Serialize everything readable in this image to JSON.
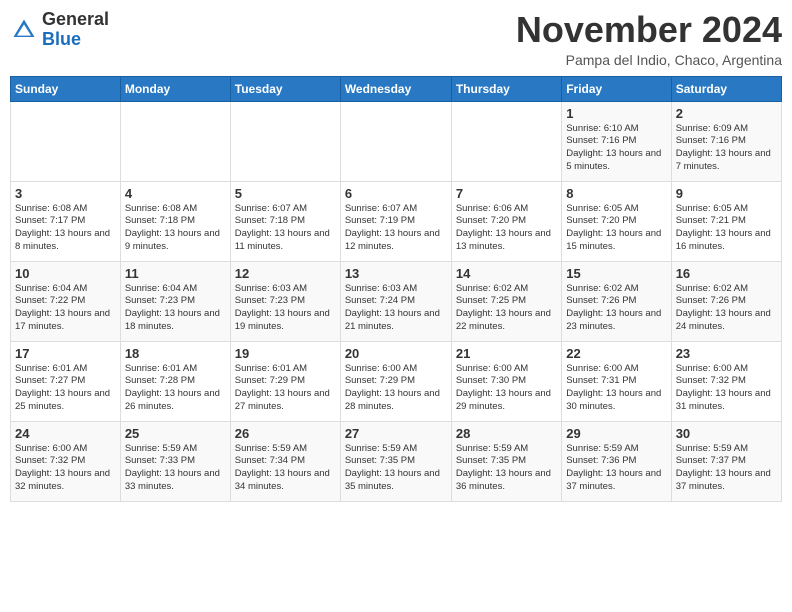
{
  "header": {
    "logo_general": "General",
    "logo_blue": "Blue",
    "month_title": "November 2024",
    "location": "Pampa del Indio, Chaco, Argentina"
  },
  "days_of_week": [
    "Sunday",
    "Monday",
    "Tuesday",
    "Wednesday",
    "Thursday",
    "Friday",
    "Saturday"
  ],
  "weeks": [
    [
      {
        "day": "",
        "info": ""
      },
      {
        "day": "",
        "info": ""
      },
      {
        "day": "",
        "info": ""
      },
      {
        "day": "",
        "info": ""
      },
      {
        "day": "",
        "info": ""
      },
      {
        "day": "1",
        "info": "Sunrise: 6:10 AM\nSunset: 7:16 PM\nDaylight: 13 hours and 5 minutes."
      },
      {
        "day": "2",
        "info": "Sunrise: 6:09 AM\nSunset: 7:16 PM\nDaylight: 13 hours and 7 minutes."
      }
    ],
    [
      {
        "day": "3",
        "info": "Sunrise: 6:08 AM\nSunset: 7:17 PM\nDaylight: 13 hours and 8 minutes."
      },
      {
        "day": "4",
        "info": "Sunrise: 6:08 AM\nSunset: 7:18 PM\nDaylight: 13 hours and 9 minutes."
      },
      {
        "day": "5",
        "info": "Sunrise: 6:07 AM\nSunset: 7:18 PM\nDaylight: 13 hours and 11 minutes."
      },
      {
        "day": "6",
        "info": "Sunrise: 6:07 AM\nSunset: 7:19 PM\nDaylight: 13 hours and 12 minutes."
      },
      {
        "day": "7",
        "info": "Sunrise: 6:06 AM\nSunset: 7:20 PM\nDaylight: 13 hours and 13 minutes."
      },
      {
        "day": "8",
        "info": "Sunrise: 6:05 AM\nSunset: 7:20 PM\nDaylight: 13 hours and 15 minutes."
      },
      {
        "day": "9",
        "info": "Sunrise: 6:05 AM\nSunset: 7:21 PM\nDaylight: 13 hours and 16 minutes."
      }
    ],
    [
      {
        "day": "10",
        "info": "Sunrise: 6:04 AM\nSunset: 7:22 PM\nDaylight: 13 hours and 17 minutes."
      },
      {
        "day": "11",
        "info": "Sunrise: 6:04 AM\nSunset: 7:23 PM\nDaylight: 13 hours and 18 minutes."
      },
      {
        "day": "12",
        "info": "Sunrise: 6:03 AM\nSunset: 7:23 PM\nDaylight: 13 hours and 19 minutes."
      },
      {
        "day": "13",
        "info": "Sunrise: 6:03 AM\nSunset: 7:24 PM\nDaylight: 13 hours and 21 minutes."
      },
      {
        "day": "14",
        "info": "Sunrise: 6:02 AM\nSunset: 7:25 PM\nDaylight: 13 hours and 22 minutes."
      },
      {
        "day": "15",
        "info": "Sunrise: 6:02 AM\nSunset: 7:26 PM\nDaylight: 13 hours and 23 minutes."
      },
      {
        "day": "16",
        "info": "Sunrise: 6:02 AM\nSunset: 7:26 PM\nDaylight: 13 hours and 24 minutes."
      }
    ],
    [
      {
        "day": "17",
        "info": "Sunrise: 6:01 AM\nSunset: 7:27 PM\nDaylight: 13 hours and 25 minutes."
      },
      {
        "day": "18",
        "info": "Sunrise: 6:01 AM\nSunset: 7:28 PM\nDaylight: 13 hours and 26 minutes."
      },
      {
        "day": "19",
        "info": "Sunrise: 6:01 AM\nSunset: 7:29 PM\nDaylight: 13 hours and 27 minutes."
      },
      {
        "day": "20",
        "info": "Sunrise: 6:00 AM\nSunset: 7:29 PM\nDaylight: 13 hours and 28 minutes."
      },
      {
        "day": "21",
        "info": "Sunrise: 6:00 AM\nSunset: 7:30 PM\nDaylight: 13 hours and 29 minutes."
      },
      {
        "day": "22",
        "info": "Sunrise: 6:00 AM\nSunset: 7:31 PM\nDaylight: 13 hours and 30 minutes."
      },
      {
        "day": "23",
        "info": "Sunrise: 6:00 AM\nSunset: 7:32 PM\nDaylight: 13 hours and 31 minutes."
      }
    ],
    [
      {
        "day": "24",
        "info": "Sunrise: 6:00 AM\nSunset: 7:32 PM\nDaylight: 13 hours and 32 minutes."
      },
      {
        "day": "25",
        "info": "Sunrise: 5:59 AM\nSunset: 7:33 PM\nDaylight: 13 hours and 33 minutes."
      },
      {
        "day": "26",
        "info": "Sunrise: 5:59 AM\nSunset: 7:34 PM\nDaylight: 13 hours and 34 minutes."
      },
      {
        "day": "27",
        "info": "Sunrise: 5:59 AM\nSunset: 7:35 PM\nDaylight: 13 hours and 35 minutes."
      },
      {
        "day": "28",
        "info": "Sunrise: 5:59 AM\nSunset: 7:35 PM\nDaylight: 13 hours and 36 minutes."
      },
      {
        "day": "29",
        "info": "Sunrise: 5:59 AM\nSunset: 7:36 PM\nDaylight: 13 hours and 37 minutes."
      },
      {
        "day": "30",
        "info": "Sunrise: 5:59 AM\nSunset: 7:37 PM\nDaylight: 13 hours and 37 minutes."
      }
    ]
  ]
}
